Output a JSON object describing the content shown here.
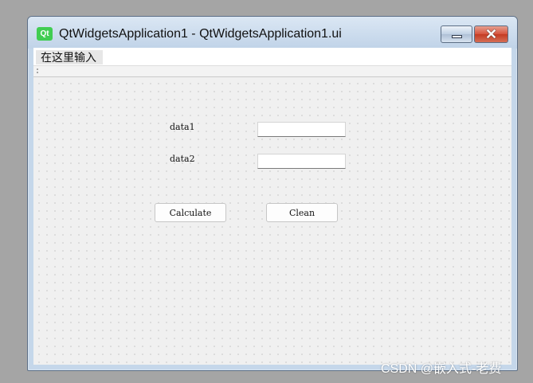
{
  "window": {
    "logo_text": "Qt",
    "title": "QtWidgetsApplication1 - QtWidgetsApplication1.ui",
    "close_glyph": "✕",
    "colors": {
      "qt_logo": "#41cd52",
      "title_bar": "#c0d3e8",
      "close_button": "#c33b23"
    }
  },
  "menubar": {
    "placeholder_item": "在这里输入"
  },
  "toolbar": {
    "grip_icon": "toolbar-grip"
  },
  "form": {
    "data1_label": "data1",
    "data1_value": "",
    "data2_label": "data2",
    "data2_value": "",
    "calculate_button": "Calculate",
    "clean_button": "Clean"
  },
  "watermark": {
    "text": "CSDN @嵌入式-老费"
  }
}
